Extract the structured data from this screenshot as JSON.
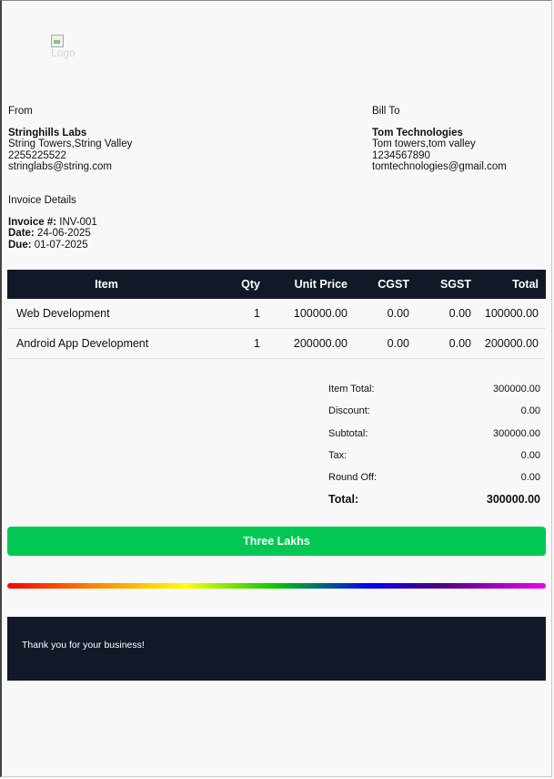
{
  "logo": {
    "alt": "Logo"
  },
  "from": {
    "heading": "From",
    "name": "Stringhills Labs",
    "address": "String Towers,String Valley",
    "phone": "2255225522",
    "email": "stringlabs@string.com"
  },
  "bill_to": {
    "heading": "Bill To",
    "name": "Tom Technologies",
    "address": "Tom towers,tom valley",
    "phone": "1234567890",
    "email": "tomtechnologies@gmail.com"
  },
  "details": {
    "heading": "Invoice Details",
    "invoice_label": "Invoice #:",
    "invoice_number": "INV-001",
    "date_label": "Date:",
    "date": "24-06-2025",
    "due_label": "Due:",
    "due": "01-07-2025"
  },
  "table": {
    "headers": {
      "item": "Item",
      "qty": "Qty",
      "unit_price": "Unit Price",
      "cgst": "CGST",
      "sgst": "SGST",
      "total": "Total"
    },
    "rows": [
      {
        "item": "Web Development",
        "qty": "1",
        "unit_price": "100000.00",
        "cgst": "0.00",
        "sgst": "0.00",
        "total": "100000.00"
      },
      {
        "item": "Android App Development",
        "qty": "1",
        "unit_price": "200000.00",
        "cgst": "0.00",
        "sgst": "0.00",
        "total": "200000.00"
      }
    ]
  },
  "summary": {
    "item_total_label": "Item Total:",
    "item_total": "300000.00",
    "discount_label": "Discount:",
    "discount": "0.00",
    "subtotal_label": "Subtotal:",
    "subtotal": "300000.00",
    "tax_label": "Tax:",
    "tax": "0.00",
    "round_off_label": "Round Off:",
    "round_off": "0.00",
    "total_label": "Total:",
    "total": "300000.00"
  },
  "amount_in_words": "Three Lakhs",
  "footer": {
    "message": "Thank you for your business!"
  },
  "colors": {
    "header_bg": "#111827",
    "accent_green": "#00c853"
  }
}
